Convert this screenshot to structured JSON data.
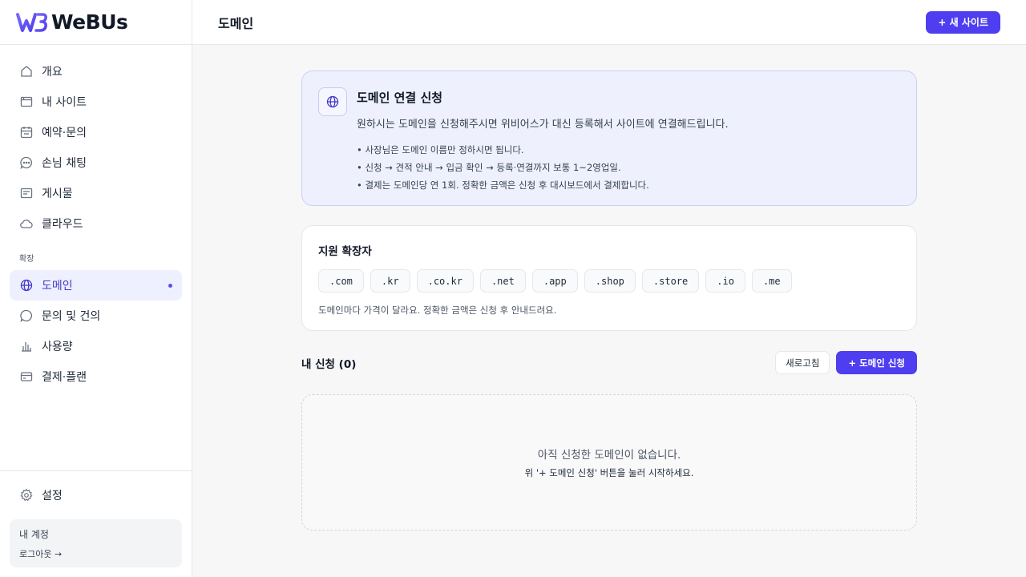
{
  "brand": {
    "name": "WeBUs"
  },
  "nav": {
    "items": [
      {
        "label": "개요",
        "icon": "home-icon"
      },
      {
        "label": "내 사이트",
        "icon": "browser-window-icon"
      },
      {
        "label": "예약·문의",
        "icon": "calendar-icon"
      },
      {
        "label": "손님 채팅",
        "icon": "chat-bubble-icon"
      },
      {
        "label": "게시물",
        "icon": "post-icon"
      },
      {
        "label": "클라우드",
        "icon": "cloud-icon"
      }
    ],
    "section_label": "확장",
    "extension_items": [
      {
        "label": "도메인",
        "icon": "globe-icon",
        "active": true
      },
      {
        "label": "문의 및 건의",
        "icon": "chat-bubble-icon"
      },
      {
        "label": "사용량",
        "icon": "bar-chart-icon"
      },
      {
        "label": "결제·플랜",
        "icon": "credit-card-icon"
      }
    ],
    "settings_label": "설정",
    "account_title": "내 계정",
    "logout_label": "로그아웃 →"
  },
  "header": {
    "title": "도메인",
    "new_site_label": "+ 새 사이트"
  },
  "info": {
    "title": "도메인 연결 신청",
    "description": "원하시는 도메인을 신청해주시면 위비어스가 대신 등록해서 사이트에 연결해드립니다.",
    "bullets": [
      "• 사장님은 도메인 이름만 정하시면 됩니다.",
      "• 신청 → 견적 안내 → 입금 확인 → 등록·연결까지 보통 1~2영업일.",
      "• 결제는 도메인당 연 1회. 정확한 금액은 신청 후 대시보드에서 결제합니다."
    ]
  },
  "extensions": {
    "title": "지원 확장자",
    "list": [
      ".com",
      ".kr",
      ".co.kr",
      ".net",
      ".app",
      ".shop",
      ".store",
      ".io",
      ".me"
    ],
    "note": "도메인마다 가격이 달라요. 정확한 금액은 신청 후 안내드려요."
  },
  "requests": {
    "title": "내 신청 (0)",
    "refresh_label": "새로고침",
    "new_request_label": "+ 도메인 신청",
    "empty_title": "아직 신청한 도메인이 없습니다.",
    "empty_sub": "위 '+ 도메인 신청' 버튼을 눌러 시작하세요."
  },
  "colors": {
    "accent": "#4f3df0",
    "active_bg": "#eef0ff",
    "info_bg": "#eef1fd"
  }
}
